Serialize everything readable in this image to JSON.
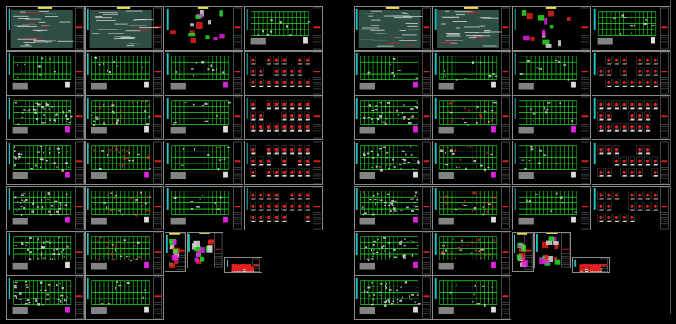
{
  "colors": {
    "background": "#000000",
    "sheet_border": "#8a8a8a",
    "grid_green": "#22e022",
    "accent_red": "#e02020",
    "accent_magenta": "#e020e0",
    "accent_cyan": "#20c0c0",
    "text_white": "#d8d8d8",
    "frame_yellow": "#c8b400"
  },
  "drawing_sets": [
    {
      "columns": [
        [
          "notes",
          "plan",
          "plan-dense",
          "plan-dense",
          "plan-dense",
          "plan-dense",
          "plan-dense"
        ],
        [
          "notes",
          "plan",
          "plan-red",
          "plan-red",
          "plan-red",
          "plan-red",
          "plan"
        ],
        [
          "details",
          "plan",
          "plan",
          "plan",
          "plan"
        ],
        [
          "plan",
          "sections",
          "sections",
          "sections",
          "sections"
        ]
      ],
      "extra_sheets": [
        "stair-small",
        "stair-medium",
        "table-small"
      ]
    },
    {
      "columns": [
        [
          "notes",
          "plan",
          "plan-dense",
          "plan-dense",
          "plan-dense",
          "plan-dense",
          "plan-dense"
        ],
        [
          "notes",
          "plan",
          "plan-red",
          "plan-red",
          "plan-red",
          "plan-red",
          "plan"
        ],
        [
          "details",
          "plan",
          "plan",
          "plan",
          "plan"
        ],
        [
          "plan",
          "sections",
          "sections",
          "sections",
          "sections"
        ]
      ],
      "extra_sheets": [
        "stair-small",
        "stair-medium",
        "table-small"
      ]
    }
  ]
}
